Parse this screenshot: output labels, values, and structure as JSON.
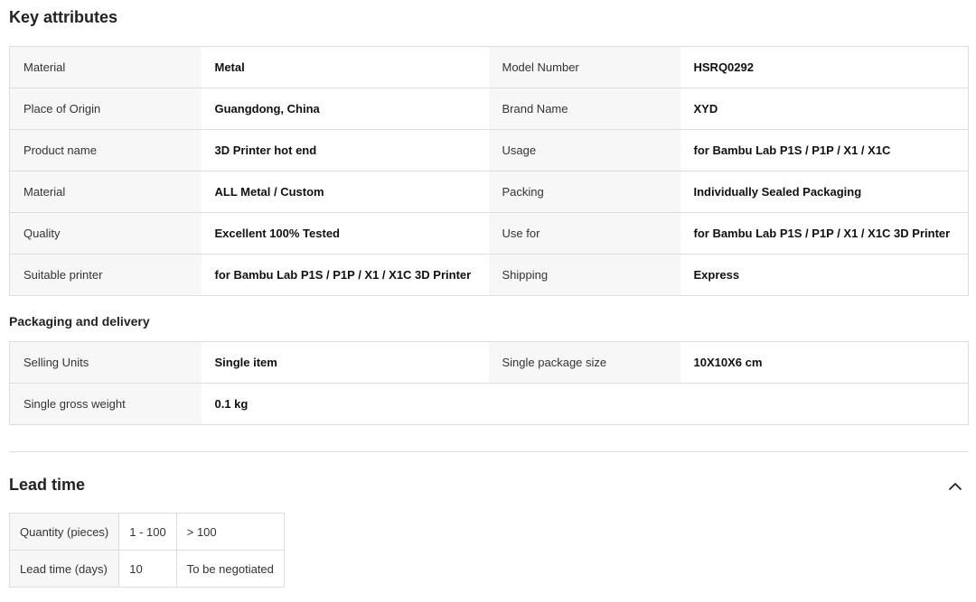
{
  "key_attributes": {
    "title": "Key attributes",
    "rows": [
      [
        {
          "k": "Material",
          "v": "Metal"
        },
        {
          "k": "Model Number",
          "v": "HSRQ0292"
        }
      ],
      [
        {
          "k": "Place of Origin",
          "v": "Guangdong, China"
        },
        {
          "k": "Brand Name",
          "v": "XYD"
        }
      ],
      [
        {
          "k": "Product name",
          "v": "3D Printer hot end"
        },
        {
          "k": "Usage",
          "v": "for Bambu Lab P1S / P1P / X1 / X1C"
        }
      ],
      [
        {
          "k": "Material",
          "v": "ALL Metal / Custom"
        },
        {
          "k": "Packing",
          "v": "Individually Sealed Packaging"
        }
      ],
      [
        {
          "k": "Quality",
          "v": "Excellent 100% Tested"
        },
        {
          "k": "Use for",
          "v": "for Bambu Lab P1S / P1P / X1 / X1C 3D Printer"
        }
      ],
      [
        {
          "k": "Suitable printer",
          "v": "for Bambu Lab P1S / P1P / X1 / X1C 3D Printer"
        },
        {
          "k": "Shipping",
          "v": "Express"
        }
      ]
    ]
  },
  "packaging": {
    "title": "Packaging and delivery",
    "rows": [
      [
        {
          "k": "Selling Units",
          "v": "Single item"
        },
        {
          "k": "Single package size",
          "v": "10X10X6 cm"
        }
      ],
      [
        {
          "k": "Single gross weight",
          "v": "0.1 kg"
        },
        {
          "k": "",
          "v": ""
        }
      ]
    ]
  },
  "lead_time": {
    "title": "Lead time",
    "collapse_icon": "chevron-up-icon",
    "quantity_header": "Quantity (pieces)",
    "quantities": [
      "1 - 100",
      "> 100"
    ],
    "lead_header": "Lead time (days)",
    "days": [
      "10",
      "To be negotiated"
    ]
  }
}
